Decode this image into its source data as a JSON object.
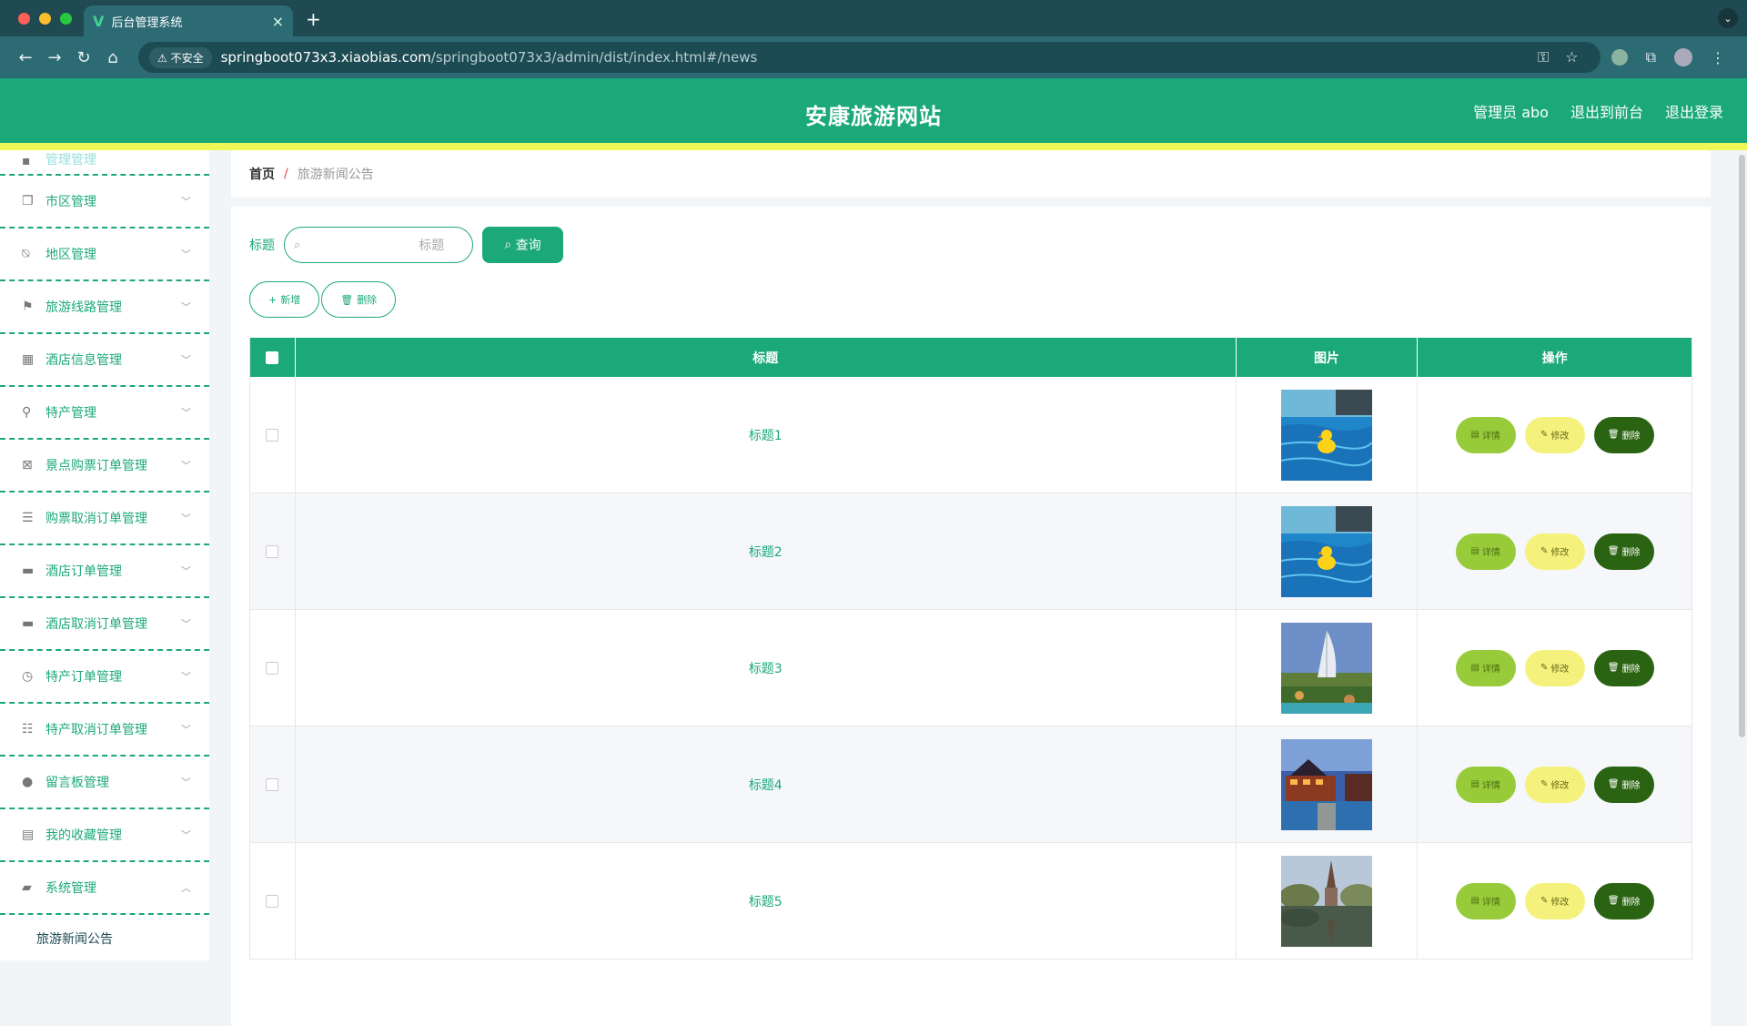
{
  "browser": {
    "tab_title": "后台管理系统",
    "insecure_label": "不安全",
    "url_host": "springboot073x3.xiaobias.com",
    "url_path": "/springboot073x3/admin/dist/index.html#/news"
  },
  "header": {
    "site_title": "安康旅游网站",
    "admin_label": "管理员 abo",
    "front_label": "退出到前台",
    "logout_label": "退出登录"
  },
  "sidebar": {
    "partial_item": "管理管理",
    "items": [
      {
        "label": "市区管理",
        "icon": "copy-icon"
      },
      {
        "label": "地区管理",
        "icon": "bell-off-icon"
      },
      {
        "label": "旅游线路管理",
        "icon": "flag-icon"
      },
      {
        "label": "酒店信息管理",
        "icon": "grid-icon"
      },
      {
        "label": "特产管理",
        "icon": "microphone-icon"
      },
      {
        "label": "景点购票订单管理",
        "icon": "clipboard-x-icon"
      },
      {
        "label": "购票取消订单管理",
        "icon": "list-icon"
      },
      {
        "label": "酒店订单管理",
        "icon": "monitor-icon"
      },
      {
        "label": "酒店取消订单管理",
        "icon": "monitor-icon"
      },
      {
        "label": "特产订单管理",
        "icon": "clock-icon"
      },
      {
        "label": "特产取消订单管理",
        "icon": "sliders-icon"
      },
      {
        "label": "留言板管理",
        "icon": "balloon-icon"
      },
      {
        "label": "我的收藏管理",
        "icon": "clipboard-icon"
      },
      {
        "label": "系统管理",
        "icon": "ticket-icon"
      }
    ],
    "sub_item": "旅游新闻公告"
  },
  "breadcrumb": {
    "home": "首页",
    "separator": "/",
    "current": "旅游新闻公告"
  },
  "search": {
    "label": "标题",
    "placeholder": "标题",
    "query_label": "查询"
  },
  "actions": {
    "add_label": "新增",
    "delete_label": "删除"
  },
  "table": {
    "headers": {
      "title": "标题",
      "image": "图片",
      "ops": "操作"
    },
    "rows": [
      {
        "title": "标题1",
        "image": "duck-pool"
      },
      {
        "title": "标题2",
        "image": "duck-pool"
      },
      {
        "title": "标题3",
        "image": "burj-al-arab"
      },
      {
        "title": "标题4",
        "image": "night-water-town"
      },
      {
        "title": "标题5",
        "image": "lake-castle"
      }
    ],
    "op_labels": {
      "detail": "详情",
      "edit": "修改",
      "delete": "删除"
    }
  },
  "colors": {
    "primary": "#1ca97a",
    "accent_yellow": "#eef755",
    "detail_btn": "#97cb3a",
    "edit_btn": "#f4f27c",
    "delete_btn": "#2a6312"
  }
}
